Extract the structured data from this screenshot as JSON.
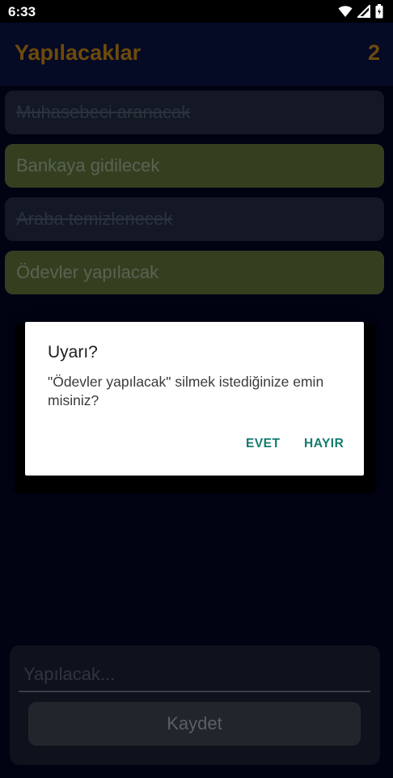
{
  "status_bar": {
    "time": "6:33",
    "icons": [
      "wifi-icon",
      "signal-icon",
      "battery-icon"
    ]
  },
  "app_bar": {
    "title": "Yapılacaklar",
    "count": "2"
  },
  "todos": [
    {
      "text": "Muhasebeci aranacak",
      "completed": true
    },
    {
      "text": "Bankaya gidilecek",
      "completed": false
    },
    {
      "text": "Araba temizlenecek",
      "completed": true
    },
    {
      "text": "Ödevler yapılacak",
      "completed": false
    }
  ],
  "input": {
    "placeholder": "Yapılacak...",
    "value": ""
  },
  "save_button": {
    "label": "Kaydet"
  },
  "dialog": {
    "title": "Uyarı?",
    "message": "\"Ödevler yapılacak\" silmek istediğinize emin misiniz?",
    "yes_label": "EVET",
    "no_label": "HAYIR"
  },
  "colors": {
    "accent_title": "#6e4a0b",
    "todo_active_bg": "#343f20",
    "todo_done_bg": "#131824",
    "dialog_button": "#137c6f"
  }
}
